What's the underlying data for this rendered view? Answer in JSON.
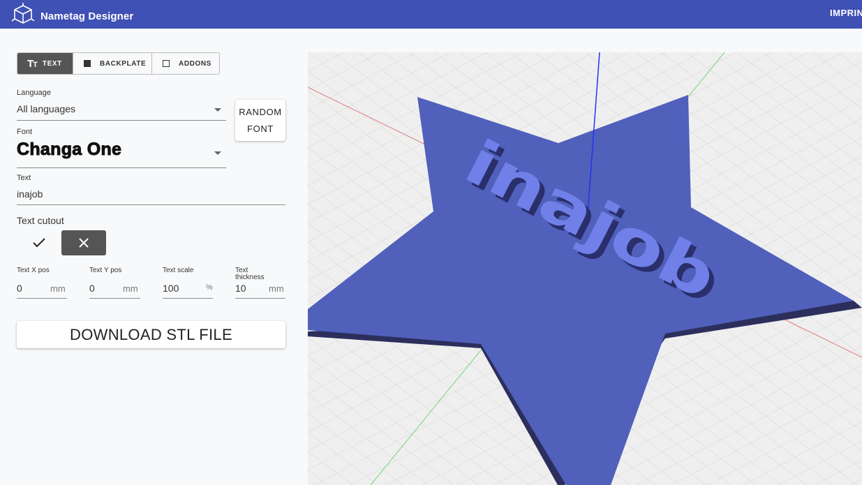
{
  "app": {
    "title": "Nametag Designer",
    "right_link": "IMPRINT",
    "logo_icon": "cube-logo-icon",
    "appbar_color": "#3f51b5"
  },
  "tabs": [
    {
      "label": "TEXT",
      "icon": "text-format-icon",
      "active": true
    },
    {
      "label": "BACKPLATE",
      "icon": "filled-square-icon",
      "active": false
    },
    {
      "label": "ADDONS",
      "icon": "outline-square-icon",
      "active": false
    }
  ],
  "language": {
    "label": "Language",
    "value": "All languages"
  },
  "random_font_button": {
    "line1": "RANDOM",
    "line2": "FONT"
  },
  "font": {
    "label": "Font",
    "value": "Changa One"
  },
  "text": {
    "label": "Text",
    "value": "inajob"
  },
  "text_cutout": {
    "label": "Text cutout",
    "selected": "off",
    "on_icon": "check-icon",
    "off_icon": "close-icon"
  },
  "params": {
    "x_pos": {
      "label": "Text X pos",
      "value": "0",
      "unit": "mm"
    },
    "y_pos": {
      "label": "Text Y pos",
      "value": "0",
      "unit": "mm"
    },
    "scale": {
      "label": "Text scale",
      "value": "100",
      "unit": "%"
    },
    "thickness": {
      "label_line1": "Text",
      "label_line2": "thickness",
      "value": "10",
      "unit": "mm"
    }
  },
  "download_button": "DOWNLOAD STL FILE",
  "preview": {
    "tag_text": "inajob",
    "plate_shape": "star",
    "plate_color": "#5060bb",
    "text_color": "#7080e8"
  }
}
